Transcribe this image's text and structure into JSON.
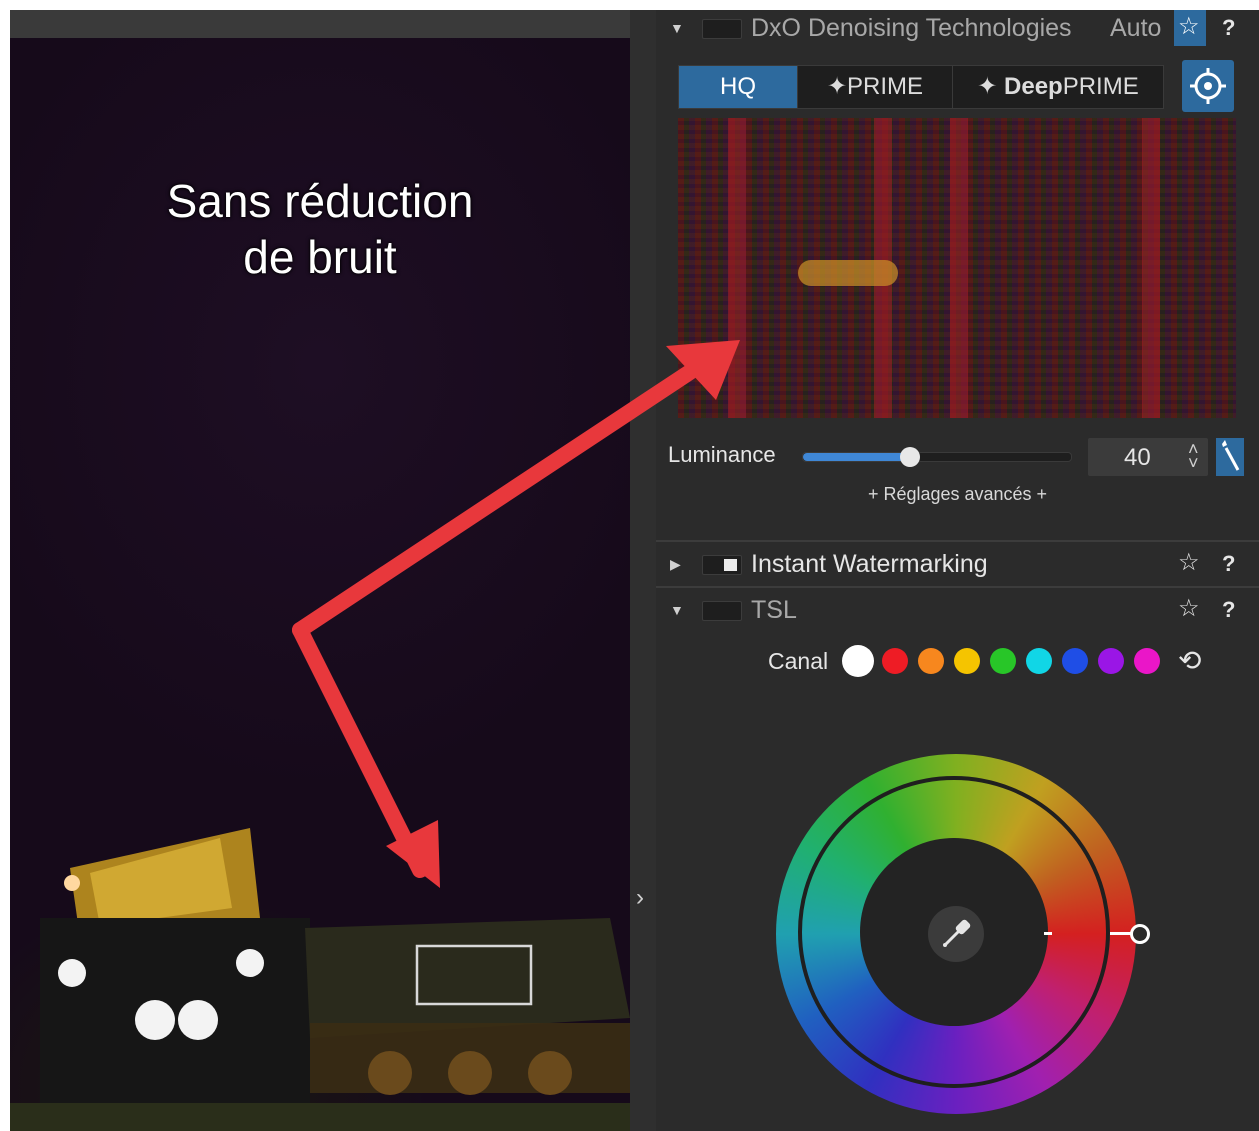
{
  "photo": {
    "caption_line1": "Sans réduction",
    "caption_line2": "de bruit"
  },
  "denoising": {
    "title": "DxO Denoising Technologies",
    "auto_label": "Auto",
    "help_label": "?",
    "modes": [
      {
        "label": "HQ",
        "active": true
      },
      {
        "label": "PRIME",
        "active": false
      },
      {
        "label_bold": "Deep",
        "label_rest": "PRIME",
        "active": false
      }
    ],
    "luminance_label": "Luminance",
    "luminance_value": "40",
    "luminance_fraction": 0.4,
    "advanced_link": "+ Réglages avancés +"
  },
  "watermark": {
    "title": "Instant Watermarking",
    "help_label": "?"
  },
  "tsl": {
    "title": "TSL",
    "help_label": "?",
    "canal_label": "Canal",
    "channels": [
      {
        "name": "master",
        "color": "#ffffff"
      },
      {
        "name": "red",
        "color": "#ee1c25"
      },
      {
        "name": "orange",
        "color": "#f7871e"
      },
      {
        "name": "yellow",
        "color": "#f5c400"
      },
      {
        "name": "green",
        "color": "#28c628"
      },
      {
        "name": "cyan",
        "color": "#11d6e6"
      },
      {
        "name": "blue",
        "color": "#1f4ee6"
      },
      {
        "name": "purple",
        "color": "#9a16e6"
      },
      {
        "name": "magenta",
        "color": "#ea16c8"
      }
    ]
  },
  "colors": {
    "accent": "#2d6a9e",
    "arrow": "#e8383c"
  }
}
